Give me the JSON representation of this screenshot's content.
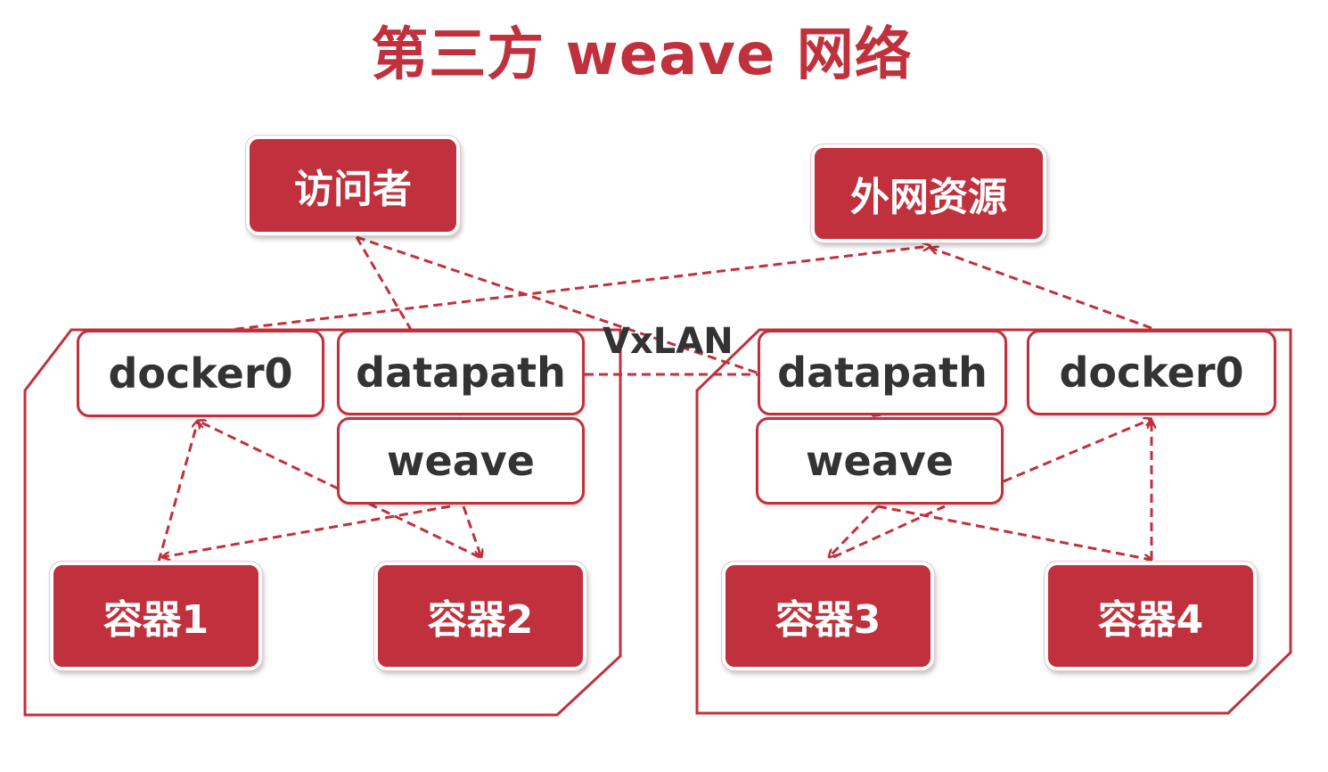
{
  "title": "第三方 weave 网络",
  "nodes": {
    "visitor": "访问者",
    "internet": "外网资源",
    "host1_docker0": "docker0",
    "host1_datapath": "datapath",
    "host1_weave": "weave",
    "container1": "容器1",
    "container2": "容器2",
    "host2_datapath": "datapath",
    "host2_docker0": "docker0",
    "host2_weave": "weave",
    "container3": "容器3",
    "container4": "容器4"
  },
  "tunnel_label": "VxLAN",
  "colors": {
    "accent": "#c0313d",
    "text": "#333333",
    "background": "#ffffff"
  }
}
